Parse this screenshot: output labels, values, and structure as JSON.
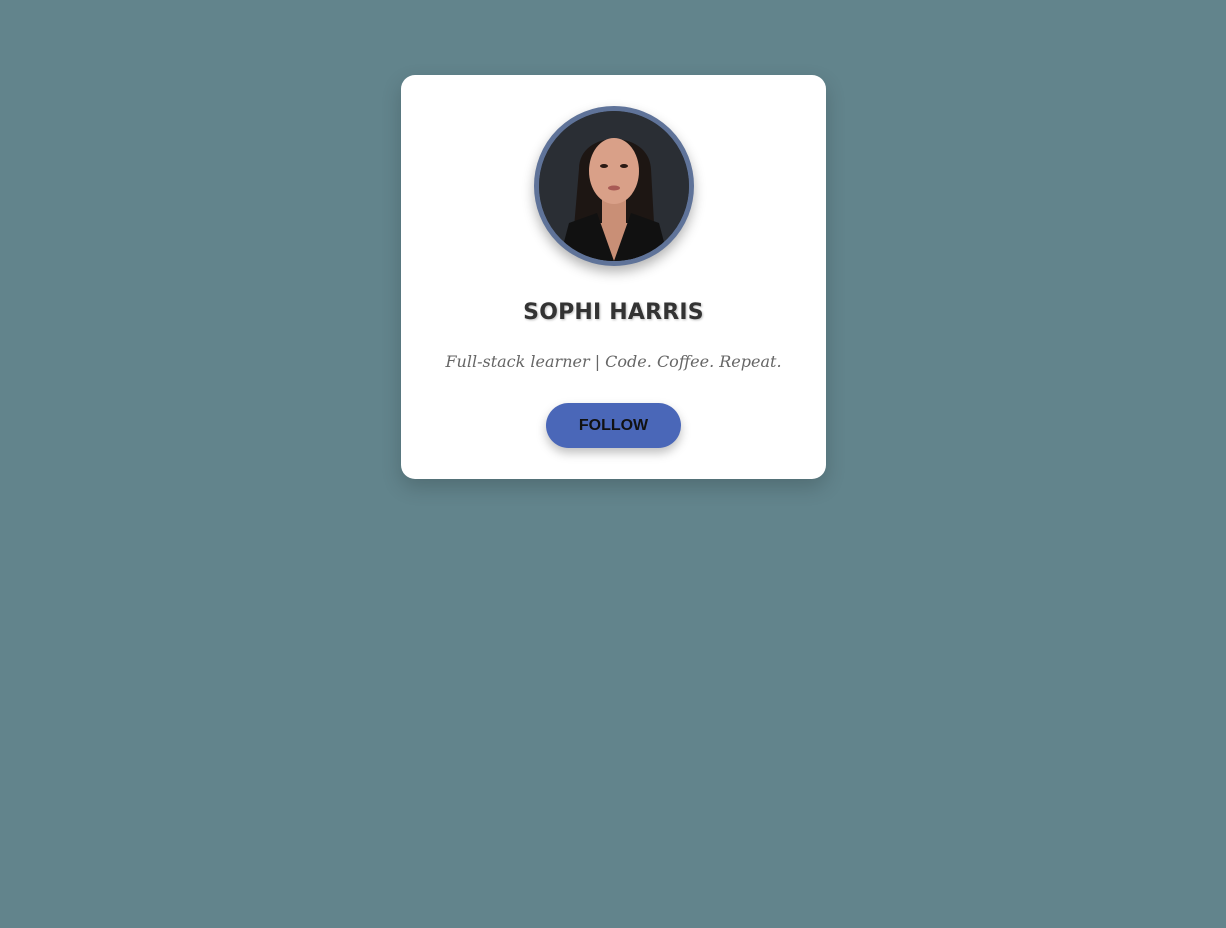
{
  "profile": {
    "name": "SOPHI HARRIS",
    "bio": "Full-stack learner | Code. Coffee. Repeat.",
    "follow_label": "FOLLOW"
  },
  "colors": {
    "background": "#62848c",
    "card": "#ffffff",
    "avatar_border": "#5f7399",
    "button": "#4a67b8"
  }
}
